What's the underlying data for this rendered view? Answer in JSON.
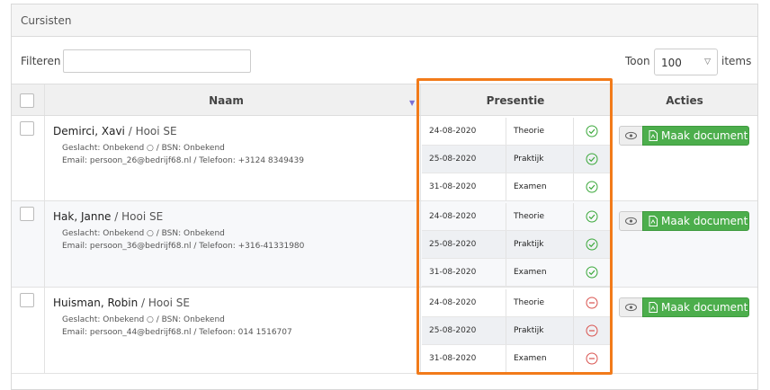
{
  "panel": {
    "title": "Cursisten"
  },
  "filter": {
    "label": "Filteren",
    "value": ""
  },
  "toon": {
    "label": "Toon",
    "selected": "100",
    "suffix": "items"
  },
  "columns": {
    "naam": "Naam",
    "presentie": "Presentie",
    "acties": "Acties"
  },
  "colors": {
    "accent_green": "#4cae4c",
    "highlight_orange": "#f27b1a",
    "present_green": "#3aa83a",
    "absent_red": "#d9534f"
  },
  "students": [
    {
      "name": "Demirci, Xavi",
      "org": " / Hooi SE",
      "line1": "Geslacht: Onbekend ○ / BSN: Onbekend",
      "line2": "Email: persoon_26@bedrijf68.nl / Telefoon: +3124 8349439",
      "presence": [
        {
          "date": "24-08-2020",
          "type": "Theorie",
          "status": "present-icon"
        },
        {
          "date": "25-08-2020",
          "type": "Praktijk",
          "status": "present-icon"
        },
        {
          "date": "31-08-2020",
          "type": "Examen",
          "status": "present-icon"
        }
      ],
      "action": "Maak document"
    },
    {
      "name": "Hak, Janne",
      "org": " / Hooi SE",
      "line1": "Geslacht: Onbekend ○ / BSN: Onbekend",
      "line2": "Email: persoon_36@bedrijf68.nl / Telefoon: +316-41331980",
      "presence": [
        {
          "date": "24-08-2020",
          "type": "Theorie",
          "status": "present-icon"
        },
        {
          "date": "25-08-2020",
          "type": "Praktijk",
          "status": "present-icon"
        },
        {
          "date": "31-08-2020",
          "type": "Examen",
          "status": "present-icon"
        }
      ],
      "action": "Maak document"
    },
    {
      "name": "Huisman, Robin",
      "org": " / Hooi SE",
      "line1": "Geslacht: Onbekend ○ / BSN: Onbekend",
      "line2": "Email: persoon_44@bedrijf68.nl / Telefoon: 014 1516707",
      "presence": [
        {
          "date": "24-08-2020",
          "type": "Theorie",
          "status": "absent-icon"
        },
        {
          "date": "25-08-2020",
          "type": "Praktijk",
          "status": "absent-icon"
        },
        {
          "date": "31-08-2020",
          "type": "Examen",
          "status": "absent-icon"
        }
      ],
      "action": "Maak document"
    }
  ]
}
